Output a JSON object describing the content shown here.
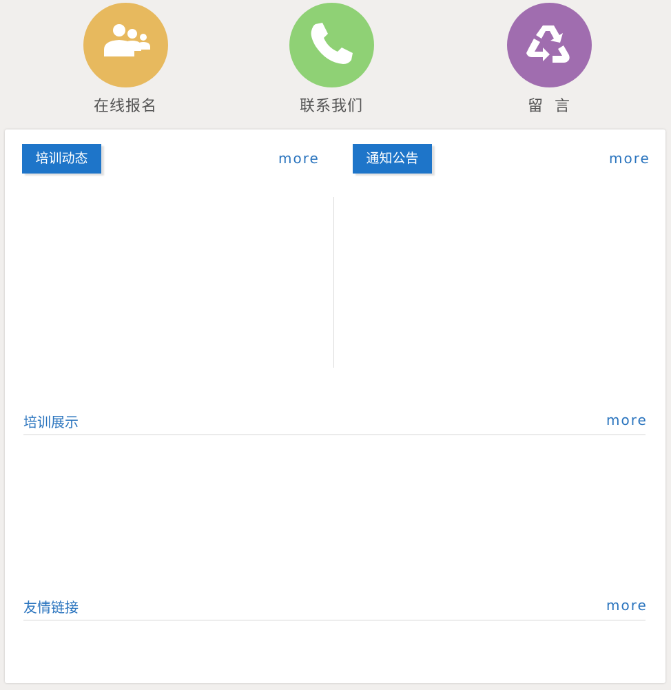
{
  "quick_links": [
    {
      "label": "在线报名",
      "icon": "users-icon",
      "color": "#e7b95e"
    },
    {
      "label": "联系我们",
      "icon": "phone-icon",
      "color": "#8fd175"
    },
    {
      "label": "留  言",
      "icon": "recycle-icon",
      "color": "#a06daf"
    }
  ],
  "panel": {
    "training_news": {
      "title": "培训动态",
      "more": "more"
    },
    "notices": {
      "title": "通知公告",
      "more": "more"
    },
    "training_showcase": {
      "title": "培训展示",
      "more": "more"
    },
    "friend_links": {
      "title": "友情链接",
      "more": "more"
    }
  },
  "colors": {
    "accent": "#1e75c9",
    "link": "#2a74be",
    "background": "#f1efed"
  }
}
